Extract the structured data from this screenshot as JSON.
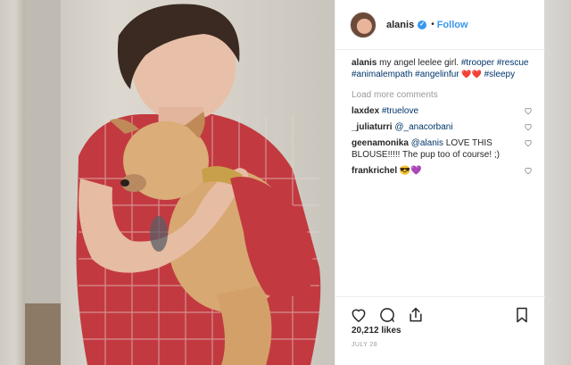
{
  "post": {
    "username": "alanis",
    "follow_label": "Follow",
    "separator": "•",
    "caption": {
      "username": "alanis",
      "text": "my angel leelee girl.",
      "tags": [
        "#trooper",
        "#rescue",
        "#animalempath",
        "#angelinfur"
      ],
      "emoji": "❤️❤️",
      "last_tag": "#sleepy"
    },
    "load_more_label": "Load more comments",
    "comments": [
      {
        "user": "laxdex",
        "text": "#truelove",
        "text_is_tag": true
      },
      {
        "user": "_juliaturri",
        "text": "@_anacorbani",
        "text_is_tag": true
      },
      {
        "user": "geenamonika",
        "mention": "@alanis",
        "text": "LOVE THIS BLOUSE!!!!! The pup too of course! ;)"
      },
      {
        "user": "frankrichel",
        "text": "😎💜",
        "text_is_tag": false
      }
    ],
    "likes": "20,212 likes",
    "date": "JULY 28"
  },
  "icons": {
    "verified": "verified-badge-icon",
    "like": "heart-icon",
    "comment": "comment-bubble-icon",
    "share": "share-icon",
    "save": "bookmark-icon"
  },
  "colors": {
    "link": "#3897f0",
    "tag": "#003569",
    "muted": "#999999",
    "text": "#262626"
  }
}
